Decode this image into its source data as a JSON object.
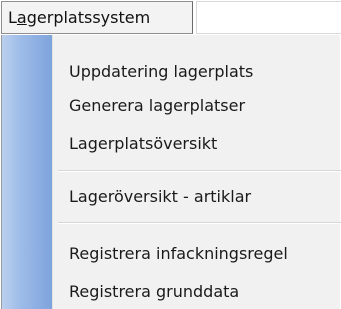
{
  "menubar": {
    "active_menu": {
      "accel": "a",
      "label_prefix": "L",
      "label_suffix": "gerplatssystem"
    }
  },
  "menu": {
    "items": [
      {
        "label": "Uppdatering lagerplats"
      },
      {
        "label": "Generera lagerplatser"
      },
      {
        "label": "Lagerplatsöversikt"
      },
      {
        "label": "Lageröversikt - artiklar"
      },
      {
        "label": "Registrera infackningsregel"
      },
      {
        "label": "Registrera grunddata"
      }
    ]
  }
}
